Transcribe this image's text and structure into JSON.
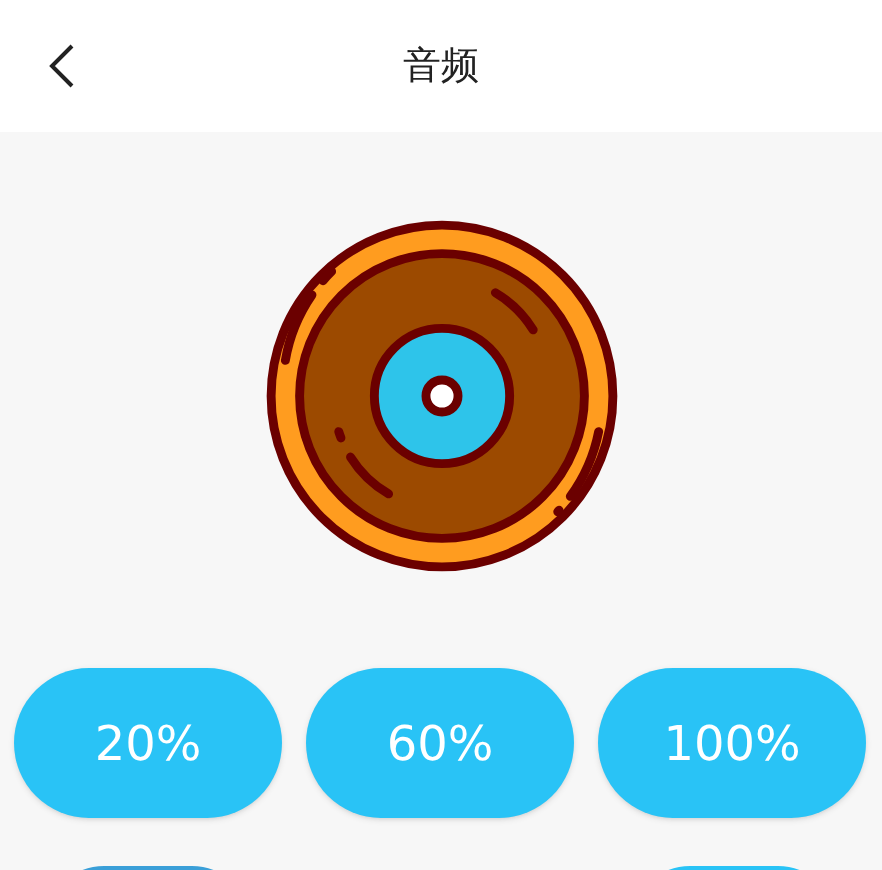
{
  "header": {
    "title": "音频"
  },
  "level_buttons": [
    {
      "label": "20%"
    },
    {
      "label": "60%"
    },
    {
      "label": "100%"
    }
  ],
  "lower_buttons": [
    {
      "selected": true
    },
    {
      "selected": false
    }
  ]
}
